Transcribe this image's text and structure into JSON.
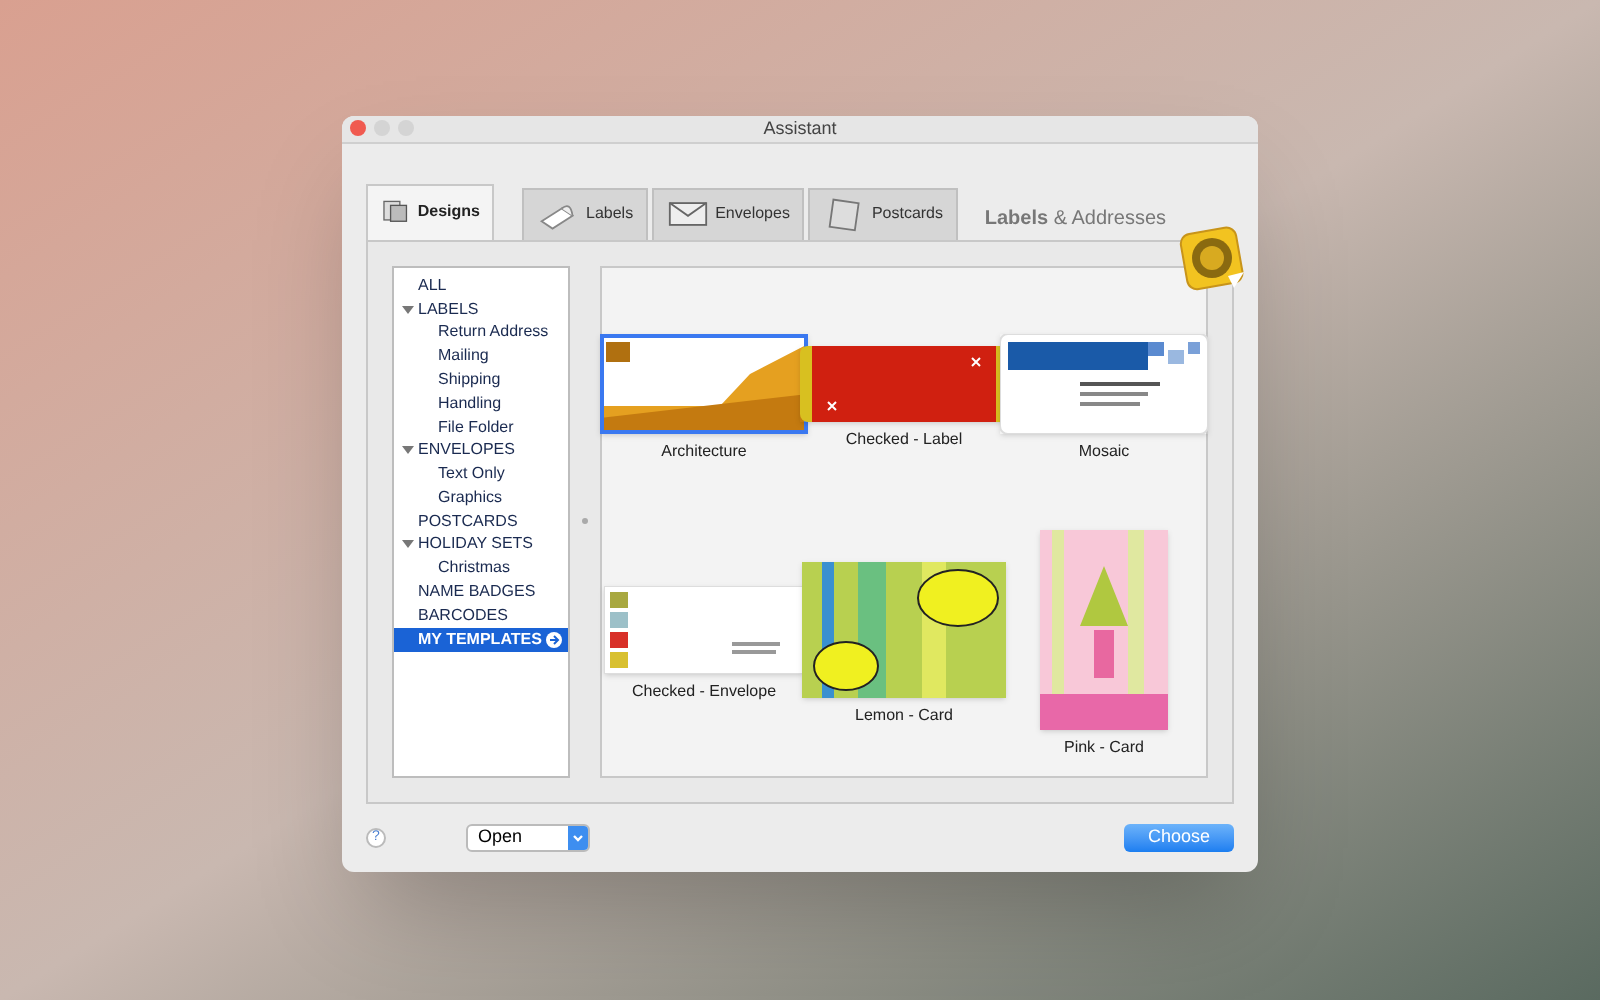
{
  "window": {
    "title": "Assistant"
  },
  "tabs": [
    {
      "label": "Designs",
      "kind": "designs",
      "selected": true
    },
    {
      "label": "Labels",
      "kind": "labels",
      "selected": false
    },
    {
      "label": "Envelopes",
      "kind": "envelopes",
      "selected": false
    },
    {
      "label": "Postcards",
      "kind": "postcards",
      "selected": false
    }
  ],
  "brand": {
    "text": "**Labels** & Addresses"
  },
  "sidebar": {
    "items": [
      {
        "label": "ALL",
        "selected": false
      },
      {
        "label": "LABELS",
        "expanded": true,
        "selected": false,
        "children": [
          {
            "label": "Return Address",
            "selected": false
          },
          {
            "label": "Mailing",
            "selected": false
          },
          {
            "label": "Shipping",
            "selected": false
          },
          {
            "label": "Handling",
            "selected": false
          },
          {
            "label": "File Folder",
            "selected": false
          }
        ]
      },
      {
        "label": "ENVELOPES",
        "expanded": true,
        "selected": false,
        "children": [
          {
            "label": "Text Only",
            "selected": false
          },
          {
            "label": "Graphics",
            "selected": false
          }
        ]
      },
      {
        "label": "POSTCARDS",
        "selected": false
      },
      {
        "label": "HOLIDAY SETS",
        "expanded": true,
        "selected": false,
        "children": [
          {
            "label": "Christmas",
            "selected": false
          }
        ]
      },
      {
        "label": "NAME BADGES",
        "selected": false
      },
      {
        "label": "BARCODES",
        "selected": false
      },
      {
        "label": "MY TEMPLATES",
        "selected": true
      }
    ]
  },
  "templates": [
    {
      "name": "Architecture",
      "kind": "architecture",
      "selected": true
    },
    {
      "name": "Checked - Label",
      "kind": "red-label",
      "selected": false
    },
    {
      "name": "Mosaic",
      "kind": "mosaic",
      "selected": false
    },
    {
      "name": "Checked - Envelope",
      "kind": "envelope",
      "selected": false
    },
    {
      "name": "Lemon - Card",
      "kind": "lemon",
      "selected": false
    },
    {
      "name": "Pink - Card",
      "kind": "pink",
      "selected": false
    }
  ],
  "footer": {
    "help": "?",
    "action": "Open",
    "button": "Choose"
  }
}
